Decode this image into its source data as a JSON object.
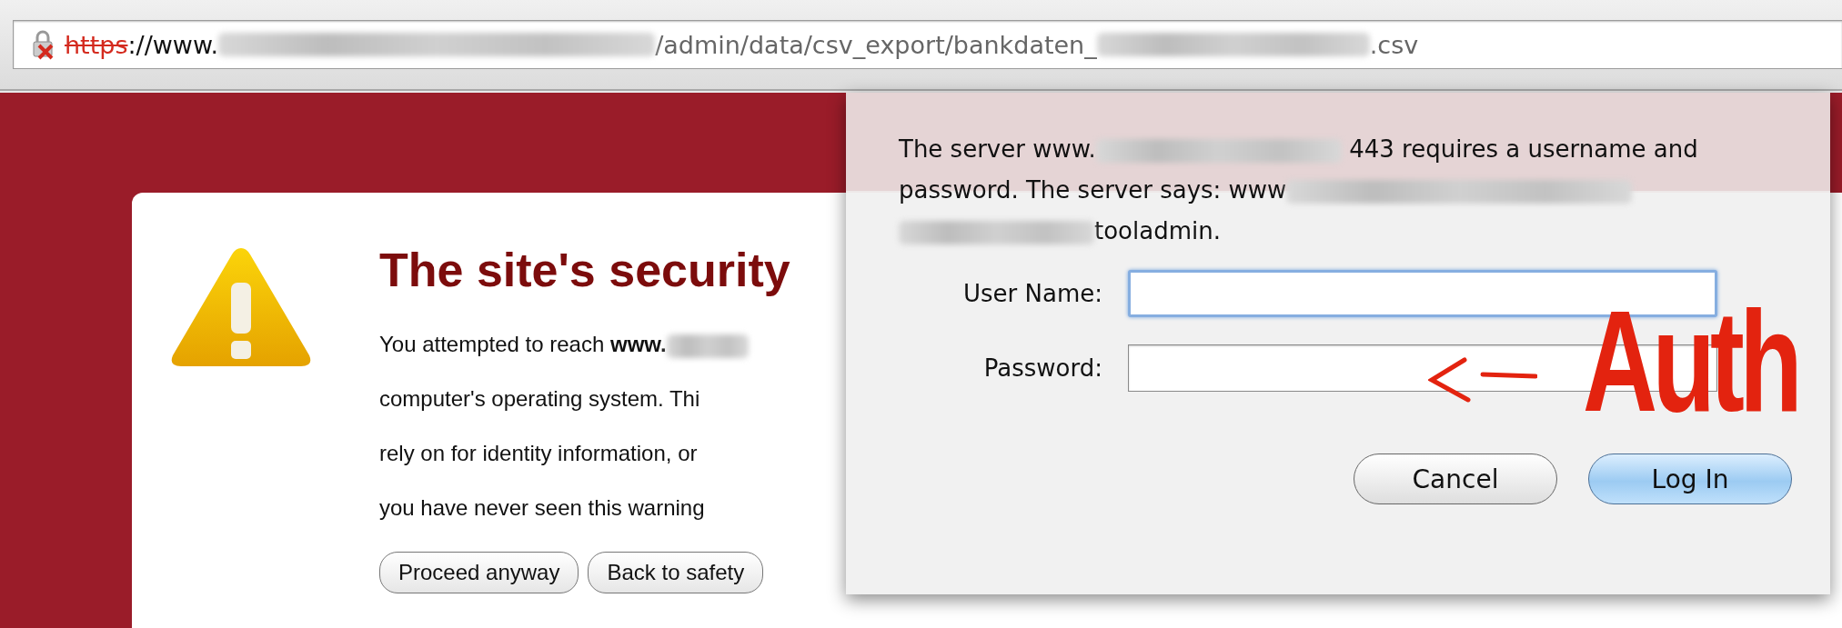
{
  "address_bar": {
    "scheme": "https",
    "host_prefix": "://www.",
    "path": "/admin/data/csv_export/bankdaten_",
    "suffix": ".csv"
  },
  "warning_page": {
    "heading": "The site's security",
    "lines": [
      {
        "text": "You attempted to reach ",
        "bold": "www.",
        "redacted": true
      },
      {
        "text": "computer's operating system. Thi",
        "redacted": false
      },
      {
        "text": "rely on for identity information, or",
        "redacted": false
      },
      {
        "text": "you have never seen this warning",
        "redacted": false
      }
    ],
    "buttons": [
      "Proceed anyway",
      "Back to safety"
    ]
  },
  "auth_dialog": {
    "message_parts": [
      "The server www.",
      "443 requires a username and password. The server says: www",
      "tooladmin."
    ],
    "fields": [
      {
        "label": "User Name:",
        "focused": true
      },
      {
        "label": "Password:",
        "focused": false
      }
    ],
    "buttons": [
      {
        "label": "Cancel",
        "default": false
      },
      {
        "label": "Log In",
        "default": true
      }
    ]
  },
  "annotation": {
    "text": "Auth"
  }
}
